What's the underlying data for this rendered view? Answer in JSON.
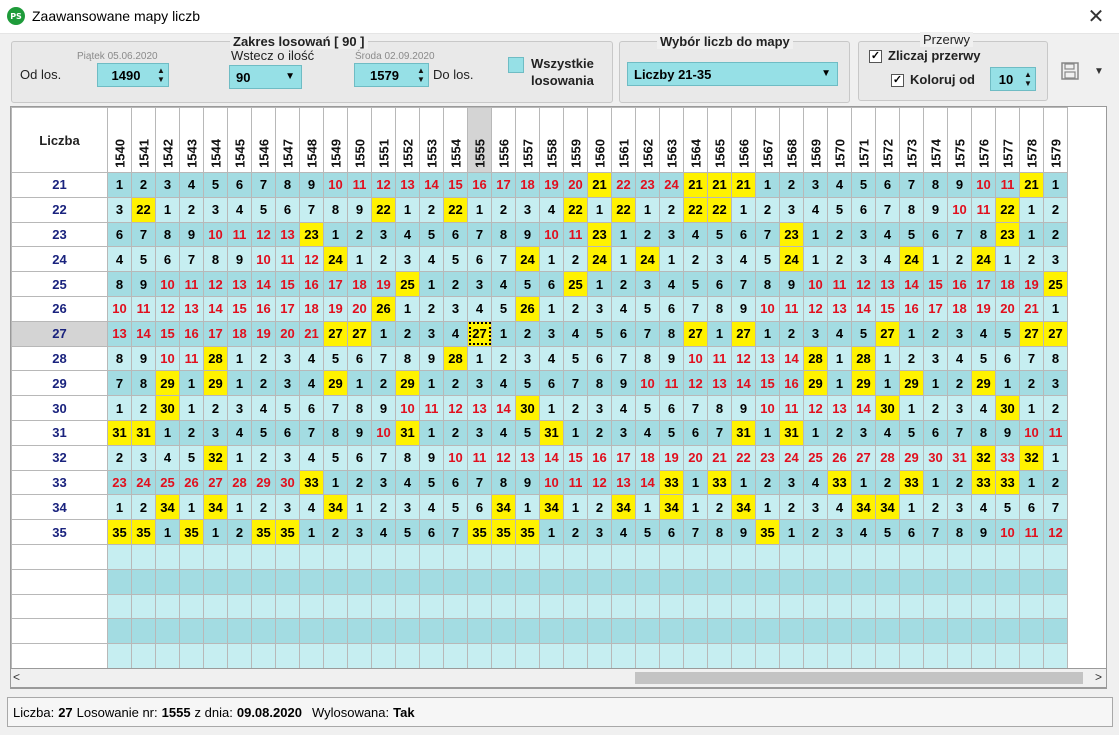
{
  "window": {
    "title": "Zaawansowane mapy liczb",
    "app_icon_text": "PS",
    "close_glyph": "✕"
  },
  "range": {
    "title": "Zakres losowań  [ 90 ]",
    "from_label": "Od los.",
    "from_date": "Piątek 05.06.2020",
    "from_value": "1490",
    "back_label": "Wstecz o ilość",
    "back_value": "90",
    "to_date": "Środa 02.09.2020",
    "to_value": "1579",
    "to_label": "Do los.",
    "all_label_1": "Wszystkie",
    "all_label_2": "losowania"
  },
  "numbers_select": {
    "title": "Wybór liczb do mapy",
    "value": "Liczby 21-35"
  },
  "gaps": {
    "title": "Przerwy",
    "count_label": "Zliczaj przerwy",
    "color_label": "Koloruj od",
    "color_value": "10"
  },
  "toolbar": {
    "save_icon": "floppy-disk-icon",
    "dropdown_glyph": "▼"
  },
  "grid": {
    "corner_label": "Liczba",
    "selected_draw": "1555",
    "selected_number": "27",
    "columns": [
      "1540",
      "1541",
      "1542",
      "1543",
      "1544",
      "1545",
      "1546",
      "1547",
      "1548",
      "1549",
      "1550",
      "1551",
      "1552",
      "1553",
      "1554",
      "1555",
      "1556",
      "1557",
      "1558",
      "1559",
      "1560",
      "1561",
      "1562",
      "1563",
      "1564",
      "1565",
      "1566",
      "1567",
      "1568",
      "1569",
      "1570",
      "1571",
      "1572",
      "1573",
      "1574",
      "1575",
      "1576",
      "1577",
      "1578",
      "1579"
    ],
    "rows": [
      {
        "number": "21",
        "cells": [
          "1",
          "2",
          "3",
          "4",
          "5",
          "6",
          "7",
          "8",
          "9",
          "10",
          "11",
          "12",
          "13",
          "14",
          "15",
          "16",
          "17",
          "18",
          "19",
          "20",
          "21",
          "22",
          "23",
          "24",
          "21",
          "21",
          "21",
          "1",
          "2",
          "3",
          "4",
          "5",
          "6",
          "7",
          "8",
          "9",
          "10",
          "11",
          "21",
          "1"
        ]
      },
      {
        "number": "22",
        "cells": [
          "3",
          "22",
          "1",
          "2",
          "3",
          "4",
          "5",
          "6",
          "7",
          "8",
          "9",
          "22",
          "1",
          "2",
          "22",
          "1",
          "2",
          "3",
          "4",
          "22",
          "1",
          "22",
          "1",
          "2",
          "22",
          "22",
          "1",
          "2",
          "3",
          "4",
          "5",
          "6",
          "7",
          "8",
          "9",
          "10",
          "11",
          "22",
          "1",
          "2"
        ]
      },
      {
        "number": "23",
        "cells": [
          "6",
          "7",
          "8",
          "9",
          "10",
          "11",
          "12",
          "13",
          "23",
          "1",
          "2",
          "3",
          "4",
          "5",
          "6",
          "7",
          "8",
          "9",
          "10",
          "11",
          "23",
          "1",
          "2",
          "3",
          "4",
          "5",
          "6",
          "7",
          "23",
          "1",
          "2",
          "3",
          "4",
          "5",
          "6",
          "7",
          "8",
          "23",
          "1",
          "2"
        ]
      },
      {
        "number": "24",
        "cells": [
          "4",
          "5",
          "6",
          "7",
          "8",
          "9",
          "10",
          "11",
          "12",
          "24",
          "1",
          "2",
          "3",
          "4",
          "5",
          "6",
          "7",
          "24",
          "1",
          "2",
          "24",
          "1",
          "24",
          "1",
          "2",
          "3",
          "4",
          "5",
          "24",
          "1",
          "2",
          "3",
          "4",
          "24",
          "1",
          "2",
          "24",
          "1",
          "2",
          "3"
        ]
      },
      {
        "number": "25",
        "cells": [
          "8",
          "9",
          "10",
          "11",
          "12",
          "13",
          "14",
          "15",
          "16",
          "17",
          "18",
          "19",
          "25",
          "1",
          "2",
          "3",
          "4",
          "5",
          "6",
          "25",
          "1",
          "2",
          "3",
          "4",
          "5",
          "6",
          "7",
          "8",
          "9",
          "10",
          "11",
          "12",
          "13",
          "14",
          "15",
          "16",
          "17",
          "18",
          "19",
          "25"
        ]
      },
      {
        "number": "26",
        "cells": [
          "10",
          "11",
          "12",
          "13",
          "14",
          "15",
          "16",
          "17",
          "18",
          "19",
          "20",
          "26",
          "1",
          "2",
          "3",
          "4",
          "5",
          "26",
          "1",
          "2",
          "3",
          "4",
          "5",
          "6",
          "7",
          "8",
          "9",
          "10",
          "11",
          "12",
          "13",
          "14",
          "15",
          "16",
          "17",
          "18",
          "19",
          "20",
          "21",
          "1"
        ]
      },
      {
        "number": "27",
        "cells": [
          "13",
          "14",
          "15",
          "16",
          "17",
          "18",
          "19",
          "20",
          "21",
          "27",
          "27",
          "1",
          "2",
          "3",
          "4",
          "27",
          "1",
          "2",
          "3",
          "4",
          "5",
          "6",
          "7",
          "8",
          "27",
          "1",
          "27",
          "1",
          "2",
          "3",
          "4",
          "5",
          "27",
          "1",
          "2",
          "3",
          "4",
          "5",
          "27",
          "27"
        ]
      },
      {
        "number": "28",
        "cells": [
          "8",
          "9",
          "10",
          "11",
          "28",
          "1",
          "2",
          "3",
          "4",
          "5",
          "6",
          "7",
          "8",
          "9",
          "28",
          "1",
          "2",
          "3",
          "4",
          "5",
          "6",
          "7",
          "8",
          "9",
          "10",
          "11",
          "12",
          "13",
          "14",
          "28",
          "1",
          "28",
          "1",
          "2",
          "3",
          "4",
          "5",
          "6",
          "7",
          "8"
        ]
      },
      {
        "number": "29",
        "cells": [
          "7",
          "8",
          "29",
          "1",
          "29",
          "1",
          "2",
          "3",
          "4",
          "29",
          "1",
          "2",
          "29",
          "1",
          "2",
          "3",
          "4",
          "5",
          "6",
          "7",
          "8",
          "9",
          "10",
          "11",
          "12",
          "13",
          "14",
          "15",
          "16",
          "29",
          "1",
          "29",
          "1",
          "29",
          "1",
          "2",
          "29",
          "1",
          "2",
          "3"
        ]
      },
      {
        "number": "30",
        "cells": [
          "1",
          "2",
          "30",
          "1",
          "2",
          "3",
          "4",
          "5",
          "6",
          "7",
          "8",
          "9",
          "10",
          "11",
          "12",
          "13",
          "14",
          "30",
          "1",
          "2",
          "3",
          "4",
          "5",
          "6",
          "7",
          "8",
          "9",
          "10",
          "11",
          "12",
          "13",
          "14",
          "30",
          "1",
          "2",
          "3",
          "4",
          "30",
          "1",
          "2"
        ]
      },
      {
        "number": "31",
        "cells": [
          "31",
          "31",
          "1",
          "2",
          "3",
          "4",
          "5",
          "6",
          "7",
          "8",
          "9",
          "10",
          "31",
          "1",
          "2",
          "3",
          "4",
          "5",
          "31",
          "1",
          "2",
          "3",
          "4",
          "5",
          "6",
          "7",
          "31",
          "1",
          "31",
          "1",
          "2",
          "3",
          "4",
          "5",
          "6",
          "7",
          "8",
          "9",
          "10",
          "11"
        ]
      },
      {
        "number": "32",
        "cells": [
          "2",
          "3",
          "4",
          "5",
          "32",
          "1",
          "2",
          "3",
          "4",
          "5",
          "6",
          "7",
          "8",
          "9",
          "10",
          "11",
          "12",
          "13",
          "14",
          "15",
          "16",
          "17",
          "18",
          "19",
          "20",
          "21",
          "22",
          "23",
          "24",
          "25",
          "26",
          "27",
          "28",
          "29",
          "30",
          "31",
          "32",
          "33",
          "32",
          "1"
        ]
      },
      {
        "number": "33",
        "cells": [
          "23",
          "24",
          "25",
          "26",
          "27",
          "28",
          "29",
          "30",
          "33",
          "1",
          "2",
          "3",
          "4",
          "5",
          "6",
          "7",
          "8",
          "9",
          "10",
          "11",
          "12",
          "13",
          "14",
          "33",
          "1",
          "33",
          "1",
          "2",
          "3",
          "4",
          "33",
          "1",
          "2",
          "33",
          "1",
          "2",
          "33",
          "33",
          "1",
          "2"
        ]
      },
      {
        "number": "34",
        "cells": [
          "1",
          "2",
          "34",
          "1",
          "34",
          "1",
          "2",
          "3",
          "4",
          "34",
          "1",
          "2",
          "3",
          "4",
          "5",
          "6",
          "34",
          "1",
          "34",
          "1",
          "2",
          "34",
          "1",
          "34",
          "1",
          "2",
          "34",
          "1",
          "2",
          "3",
          "4",
          "34",
          "34",
          "1",
          "2",
          "3",
          "4",
          "5",
          "6",
          "7"
        ]
      },
      {
        "number": "35",
        "cells": [
          "35",
          "35",
          "1",
          "35",
          "1",
          "2",
          "35",
          "35",
          "1",
          "2",
          "3",
          "4",
          "5",
          "6",
          "7",
          "35",
          "35",
          "35",
          "1",
          "2",
          "3",
          "4",
          "5",
          "6",
          "7",
          "8",
          "9",
          "35",
          "1",
          "2",
          "3",
          "4",
          "5",
          "6",
          "7",
          "8",
          "9",
          "10",
          "11",
          "12"
        ]
      }
    ],
    "empty_rows": 5
  },
  "scrollbar": {
    "left_glyph": "<",
    "right_glyph": ">"
  },
  "status": {
    "number_label": "Liczba:",
    "number_value": "27",
    "draw_label": "Losowanie nr:",
    "draw_value": "1555",
    "date_label": "z dnia:",
    "date_value": "09.08.2020",
    "drawn_label": "Wylosowana:",
    "drawn_value": "Tak"
  },
  "colors": {
    "hit": "#fff200",
    "gap_red": "#e0101e",
    "cell_dark": "#a3dce2",
    "cell_light": "#c6eef1"
  }
}
